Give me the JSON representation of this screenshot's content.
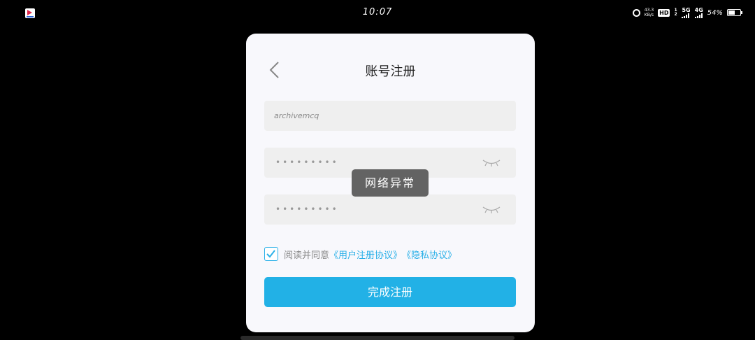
{
  "status_bar": {
    "time": "10:07",
    "net_speed_value": "43.3",
    "net_speed_unit": "KB/s",
    "hd_label": "HD",
    "hd_sub": "1 2",
    "signal_1": "5G",
    "signal_2": "4G",
    "battery_percent": "54%",
    "battery_level": 0.54,
    "icons": [
      "app-icon",
      "alarm-icon",
      "signal-icon",
      "battery-icon"
    ]
  },
  "register": {
    "title": "账号注册",
    "username_value": "archivemcq",
    "password_mask": "•••••••••",
    "confirm_mask": "•••••••••",
    "agree_prefix": "阅读并同意",
    "user_agreement": "《用户注册协议》",
    "privacy_policy": "《隐私协议》",
    "agree_checked": true,
    "submit_label": "完成注册"
  },
  "toast": {
    "message": "网络异常"
  },
  "colors": {
    "accent": "#22b1e6",
    "card_bg": "#f8f8fc",
    "field_bg": "#efefef",
    "toast_bg": "#636363"
  }
}
